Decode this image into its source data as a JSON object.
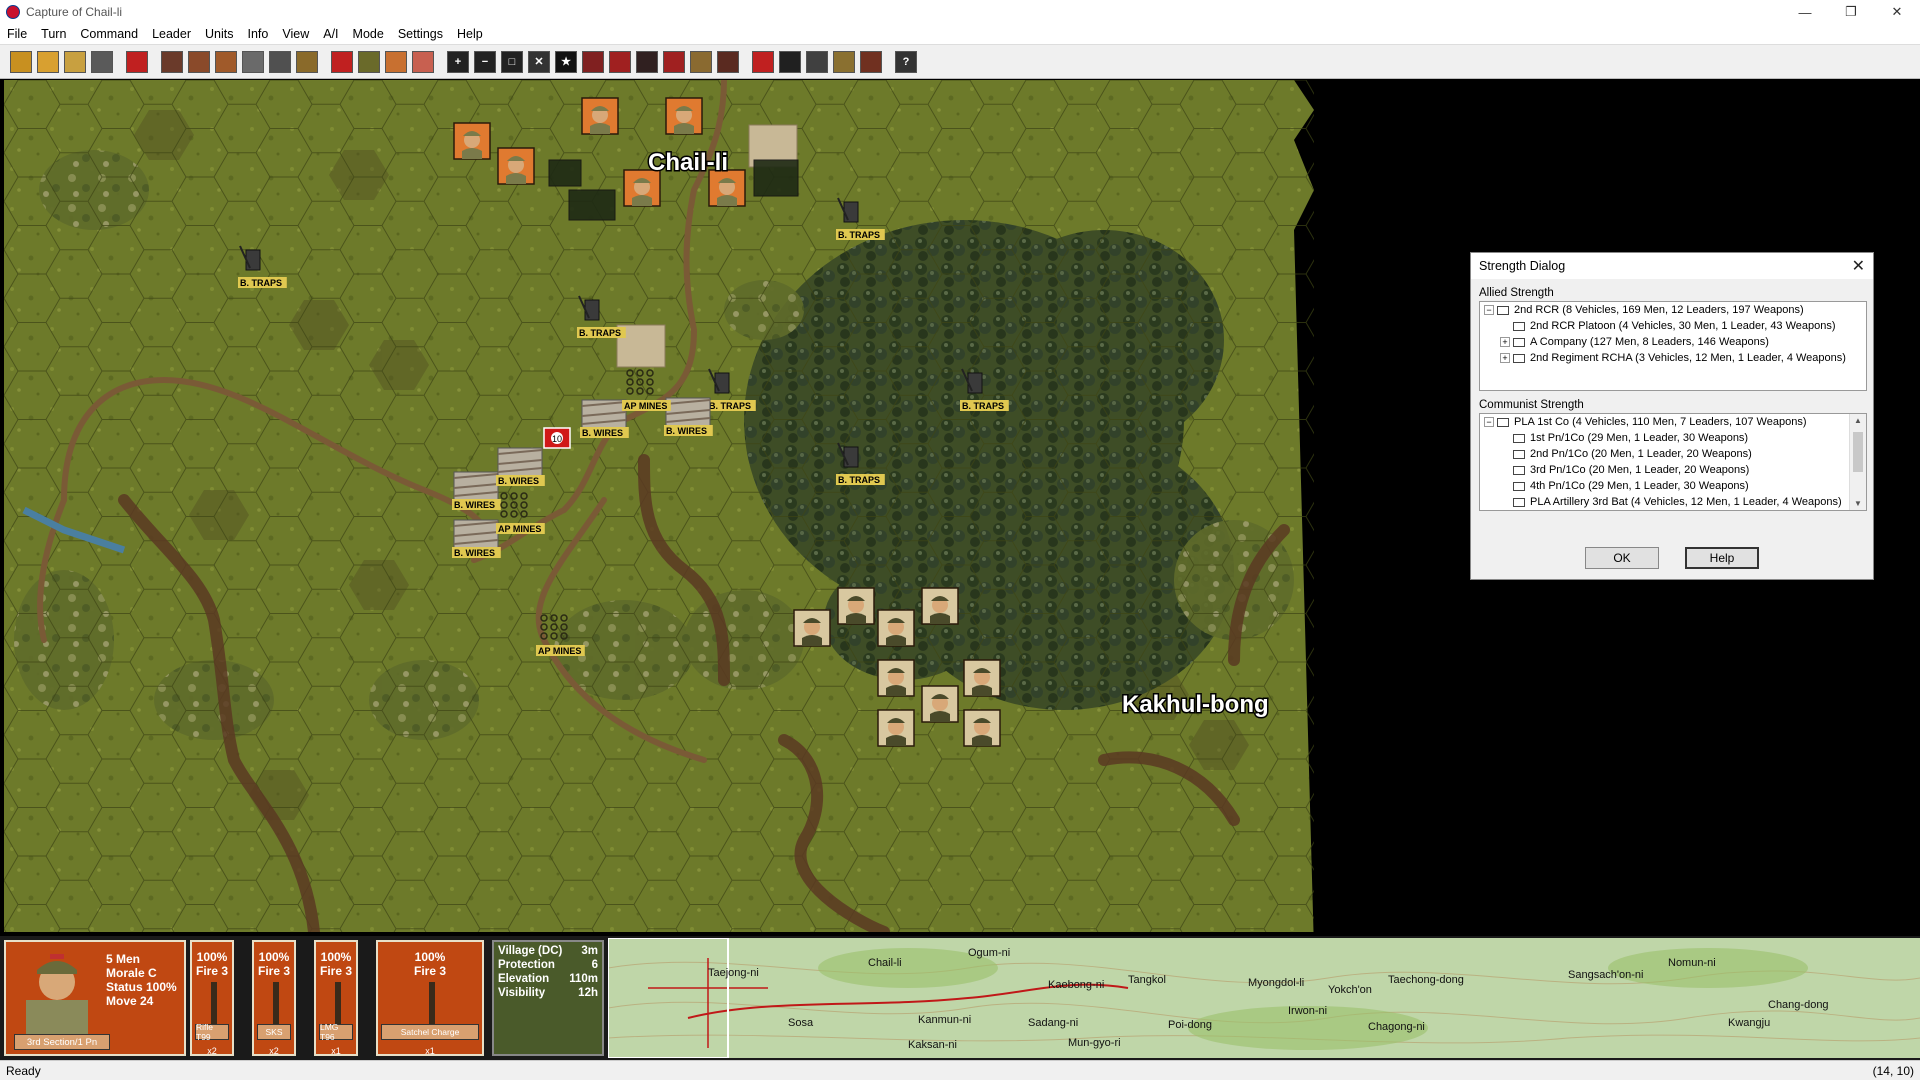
{
  "window": {
    "title": "Capture of Chail-li",
    "minimize": "—",
    "restore": "❐",
    "close": "✕"
  },
  "menu": [
    "File",
    "Turn",
    "Command",
    "Leader",
    "Units",
    "Info",
    "View",
    "A/I",
    "Mode",
    "Settings",
    "Help"
  ],
  "toolbar_icons": [
    "options-icon",
    "open-file-icon",
    "folder-icon",
    "save-icon",
    "jump-icon",
    "unit-icon",
    "unit2-icon",
    "unit3-icon",
    "unit4-icon",
    "unit5-icon",
    "column-icon",
    "flag-icon",
    "info-icon",
    "move-icon",
    "leader-icon",
    "zoom-in-icon",
    "zoom-out-icon",
    "box-icon",
    "x-icon",
    "star-icon",
    "fire-icon",
    "assault-icon",
    "loop-icon",
    "target-icon",
    "artillery-icon",
    "air-icon",
    "red-icon",
    "binocular-icon",
    "radio-icon",
    "explode-icon",
    "end-icon",
    "help-icon"
  ],
  "map": {
    "labels": {
      "village1": "Chail-li",
      "village2": "Kakhul-bong"
    },
    "obstacles": {
      "btraps": "B. TRAPS",
      "bwires": "B. WIRES",
      "apmines": "AP MINES"
    },
    "marker": "10"
  },
  "strength_dialog": {
    "title": "Strength Dialog",
    "close": "✕",
    "allied_label": "Allied Strength",
    "allied": [
      {
        "exp": "−",
        "text": "2nd RCR  (8 Vehicles, 169 Men, 12 Leaders, 197 Weapons)",
        "indent": 0
      },
      {
        "exp": "",
        "text": "2nd RCR Platoon (4 Vehicles, 30 Men, 1 Leader, 43 Weapons)",
        "indent": 1
      },
      {
        "exp": "+",
        "text": "A Company (127 Men, 8 Leaders, 146 Weapons)",
        "indent": 1
      },
      {
        "exp": "+",
        "text": "2nd Regiment RCHA (3 Vehicles, 12 Men, 1 Leader, 4 Weapons)",
        "indent": 1
      }
    ],
    "communist_label": "Communist Strength",
    "communist": [
      {
        "exp": "−",
        "text": "PLA 1st Co (4 Vehicles, 110 Men, 7 Leaders, 107 Weapons)",
        "indent": 0
      },
      {
        "exp": "",
        "text": "1st Pn/1Co (29 Men, 1 Leader, 30 Weapons)",
        "indent": 1
      },
      {
        "exp": "",
        "text": "2nd Pn/1Co (20 Men, 1 Leader, 20 Weapons)",
        "indent": 1
      },
      {
        "exp": "",
        "text": "3rd Pn/1Co (20 Men, 1 Leader, 20 Weapons)",
        "indent": 1
      },
      {
        "exp": "",
        "text": "4th Pn/1Co (29 Men, 1 Leader, 30 Weapons)",
        "indent": 1
      },
      {
        "exp": "",
        "text": "PLA Artillery 3rd Bat (4 Vehicles, 12 Men, 1 Leader, 4 Weapons)",
        "indent": 1
      }
    ],
    "ok": "OK",
    "help": "Help"
  },
  "unit": {
    "men": "5 Men",
    "morale": "Morale C",
    "status": "Status 100%",
    "move": "Move 24",
    "name": "3rd Section/1 Pn"
  },
  "weapons": [
    {
      "pct": "100%",
      "fire": "Fire 3",
      "name": "Rifle T99",
      "qty": "x2"
    },
    {
      "pct": "100%",
      "fire": "Fire 3",
      "name": "SKS",
      "qty": "x2"
    },
    {
      "pct": "100%",
      "fire": "Fire 3",
      "name": "LMG T96",
      "qty": "x1"
    },
    {
      "pct": "100%",
      "fire": "Fire 3",
      "name": "Satchel Charge",
      "qty": "x1"
    }
  ],
  "terrain": [
    {
      "label": "Village (DC)",
      "value": "3m"
    },
    {
      "label": "Protection",
      "value": "6"
    },
    {
      "label": "Elevation",
      "value": "110m"
    },
    {
      "label": "Visibility",
      "value": "12h"
    }
  ],
  "minimap_labels": [
    "Taejong-ni",
    "Chail-li",
    "Ogum-ni",
    "Kaebong-ni",
    "Tangkol",
    "Sosa",
    "Kanmun-ni",
    "Sadang-ni",
    "Poi-dong",
    "Myongdol-li",
    "Yokch'on",
    "Taechong-dong",
    "Chagong-ni",
    "Sangsach'on-ni",
    "Kwangju",
    "Chang-dong",
    "Irwon-ni",
    "Nomun-ni",
    "Mun-gyo-ri",
    "Kaksan-ni"
  ],
  "status": {
    "left": "Ready",
    "right": "(14, 10)"
  },
  "colors": {
    "german_counter": "#e07a30",
    "allied_counter": "#d8c8a0",
    "menu_bg": "#ffffff"
  }
}
